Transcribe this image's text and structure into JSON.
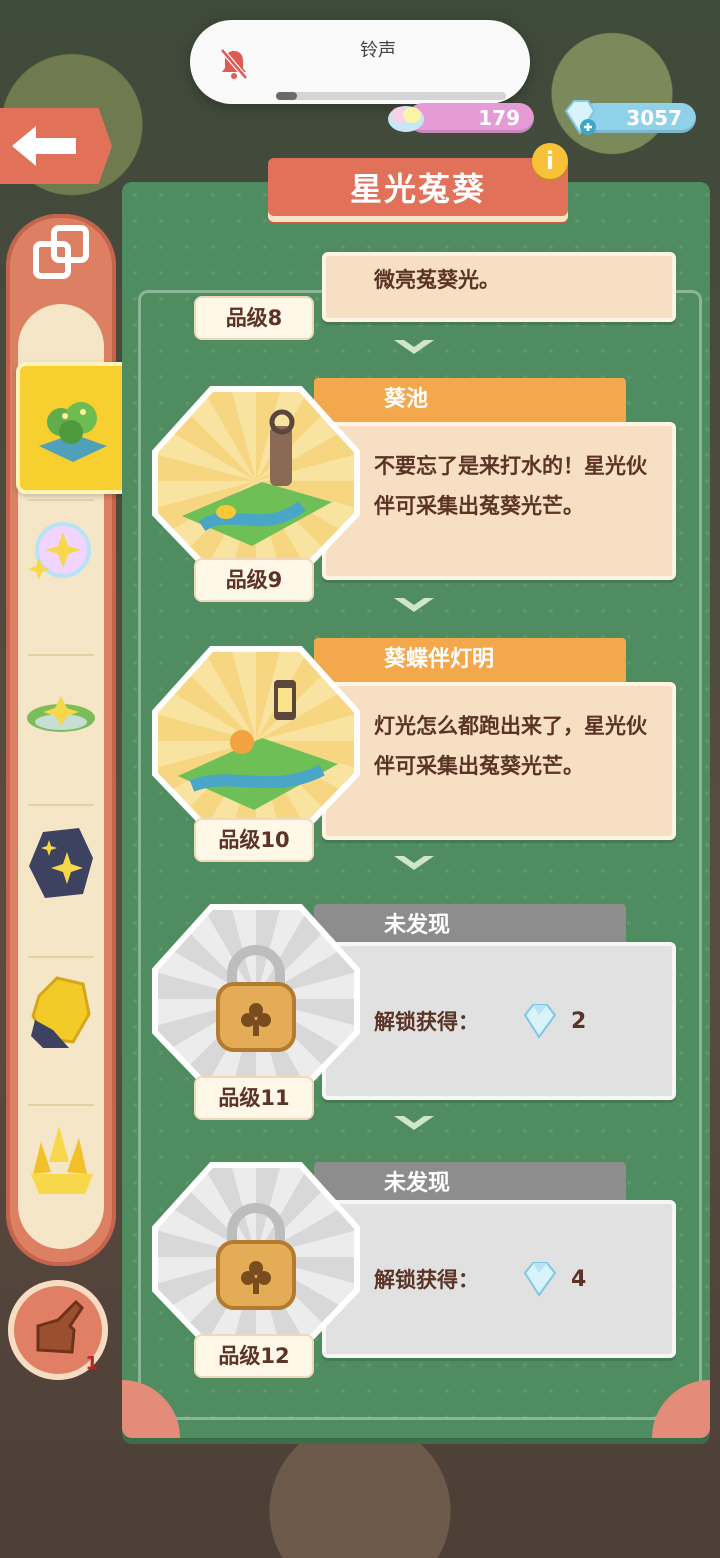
{
  "toast": {
    "title": "铃声",
    "volume_fraction": 0.09,
    "icon": "bell-muted-icon"
  },
  "currency": {
    "rainbow": {
      "value": "179",
      "icon": "rainbow-cloud-icon"
    },
    "diamond": {
      "value": "3057",
      "icon": "diamond-plus-icon"
    }
  },
  "panel": {
    "title": "星光菟葵"
  },
  "entries": [
    {
      "level": "品级8",
      "desc": "微亮菟葵光。"
    },
    {
      "name": "葵池",
      "desc": "不要忘了是来打水的！星光伙伴可采集出菟葵光芒。",
      "level": "品级9"
    },
    {
      "name": "葵蝶伴灯明",
      "desc": "灯光怎么都跑出来了，星光伙伴可采集出菟葵光芒。",
      "level": "品级10"
    },
    {
      "name": "未发现",
      "unlock_label": "解锁获得：",
      "reward": "2",
      "level": "品级11"
    },
    {
      "name": "未发现",
      "unlock_label": "解锁获得：",
      "reward": "4",
      "level": "品级12"
    }
  ],
  "sidebar": {
    "items": [
      {
        "icon": "garden-fountain-icon",
        "selected": true
      },
      {
        "icon": "star-bubble-icon"
      },
      {
        "icon": "grass-mound-icon"
      },
      {
        "icon": "dark-rock-icon"
      },
      {
        "icon": "gold-ore-icon"
      },
      {
        "icon": "gold-crystal-icon"
      }
    ]
  },
  "hand_button": {
    "count": "1"
  }
}
